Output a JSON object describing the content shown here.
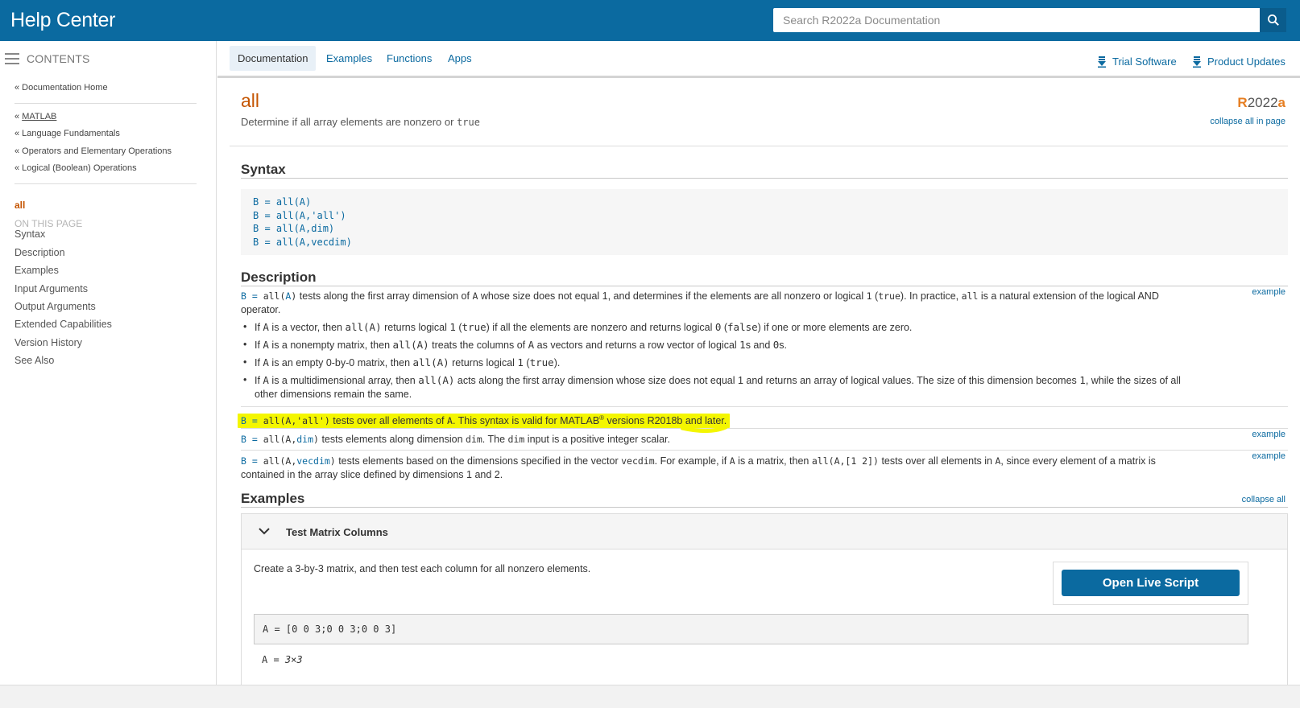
{
  "header": {
    "brand": "Help Center",
    "search_placeholder": "Search R2022a Documentation"
  },
  "sidebar": {
    "contents_label": "CONTENTS",
    "doc_home": "« Documentation Home",
    "breadcrumbs": [
      {
        "prefix": "« ",
        "label": "MATLAB"
      },
      {
        "prefix": "",
        "label": "« Language Fundamentals"
      },
      {
        "prefix": "",
        "label": "« Operators and Elementary Operations"
      },
      {
        "prefix": "",
        "label": "« Logical (Boolean) Operations"
      }
    ],
    "current": "all",
    "on_this_page": "ON THIS PAGE",
    "items": [
      "Syntax",
      "Description",
      "Examples",
      "Input Arguments",
      "Output Arguments",
      "Extended Capabilities",
      "Version History",
      "See Also"
    ]
  },
  "tabs": [
    "Documentation",
    "Examples",
    "Functions",
    "Apps"
  ],
  "utility": {
    "trial": "Trial Software",
    "updates": "Product Updates"
  },
  "page": {
    "title": "all",
    "purpose_text": "Determine if all array elements are nonzero or ",
    "purpose_code": "true",
    "release_r": "R",
    "release_rest": "2022",
    "release_a": "a",
    "collapse_all_in_page": "collapse all in page"
  },
  "syntax": {
    "heading": "Syntax",
    "lines": [
      "B = all(A)",
      "B = all(A,'all')",
      "B = all(A,dim)",
      "B = all(A,vecdim)"
    ]
  },
  "description": {
    "heading": "Description",
    "example_label": "example",
    "p1": {
      "c1": "B = ",
      "c2": "all(",
      "c3": "A",
      "c4": ")",
      "t1": " tests along the first array dimension of ",
      "c5": "A",
      "t2": " whose size does not equal 1, and determines if the elements are all nonzero or logical ",
      "c6": "1",
      "t3": " (",
      "c7": "true",
      "t4": "). In practice, ",
      "c8": "all",
      "t5": " is a natural extension of the logical AND operator."
    },
    "bullets": [
      {
        "a": "If ",
        "b": "A",
        "c": " is a vector, then ",
        "d": "all(A)",
        "e": " returns logical ",
        "f": "1",
        "g": " (",
        "h": "true",
        "i": ") if all the elements are nonzero and returns logical ",
        "j": "0",
        "k": " (",
        "l": "false",
        "m": ") if one or more elements are zero."
      },
      {
        "a": "If ",
        "b": "A",
        "c": " is a nonempty matrix, then ",
        "d": "all(A)",
        "e": " treats the columns of ",
        "f": "A",
        "g": " as vectors and returns a row vector of logical ",
        "h": "1",
        "i": "s and ",
        "j": "0",
        "k": "s.",
        "l": "",
        "m": ""
      },
      {
        "a": "If ",
        "b": "A",
        "c": " is an empty 0-by-0 matrix, then ",
        "d": "all(A)",
        "e": " returns logical ",
        "f": "1",
        "g": " (",
        "h": "true",
        "i": ").",
        "j": "",
        "k": "",
        "l": "",
        "m": ""
      },
      {
        "a": "If ",
        "b": "A",
        "c": " is a multidimensional array, then ",
        "d": "all(A)",
        "e": " acts along the first array dimension whose size does not equal 1 and returns an array of logical values. The size of this dimension becomes ",
        "f": "1",
        "g": ", while the sizes of all other dimensions remain the same.",
        "h": "",
        "i": "",
        "j": "",
        "k": "",
        "l": "",
        "m": ""
      }
    ],
    "p2": {
      "c1": "B = ",
      "c2": "all(A,'all')",
      "t1": " tests over all elements of ",
      "c3": "A",
      "t2": ". This syntax is valid for MATLAB",
      "sup": "®",
      "t3": " versions R2018b and later."
    },
    "p3": {
      "c1": "B = ",
      "c2": "all(A,",
      "c3": "dim",
      "c4": ")",
      "t1": " tests elements along dimension ",
      "c5": "dim",
      "t2": ". The ",
      "c6": "dim",
      "t3": " input is a positive integer scalar."
    },
    "p4": {
      "c1": "B = ",
      "c2": "all(A,",
      "c3": "vecdim",
      "c4": ")",
      "t1": " tests elements based on the dimensions specified in the vector ",
      "c5": "vecdim",
      "t2": ". For example, if ",
      "c6": "A",
      "t3": " is a matrix, then ",
      "c7": "all(A,[1 2])",
      "t4": " tests over all elements in ",
      "c8": "A",
      "t5": ", since every element of a matrix is contained in the array slice defined by dimensions 1 and 2."
    }
  },
  "examples": {
    "heading": "Examples",
    "collapse_all": "collapse all",
    "panel_title": "Test Matrix Columns",
    "text": "Create a 3-by-3 matrix, and then test each column for all nonzero elements.",
    "live_script": "Open Live Script",
    "code": "A = [0 0 3;0 0 3;0 0 3]",
    "output_prefix": "A = ",
    "output_size": "3×3"
  },
  "colors": {
    "brand": "#0b6aa0",
    "accent": "#c45400",
    "highlight": "#f4f600"
  }
}
